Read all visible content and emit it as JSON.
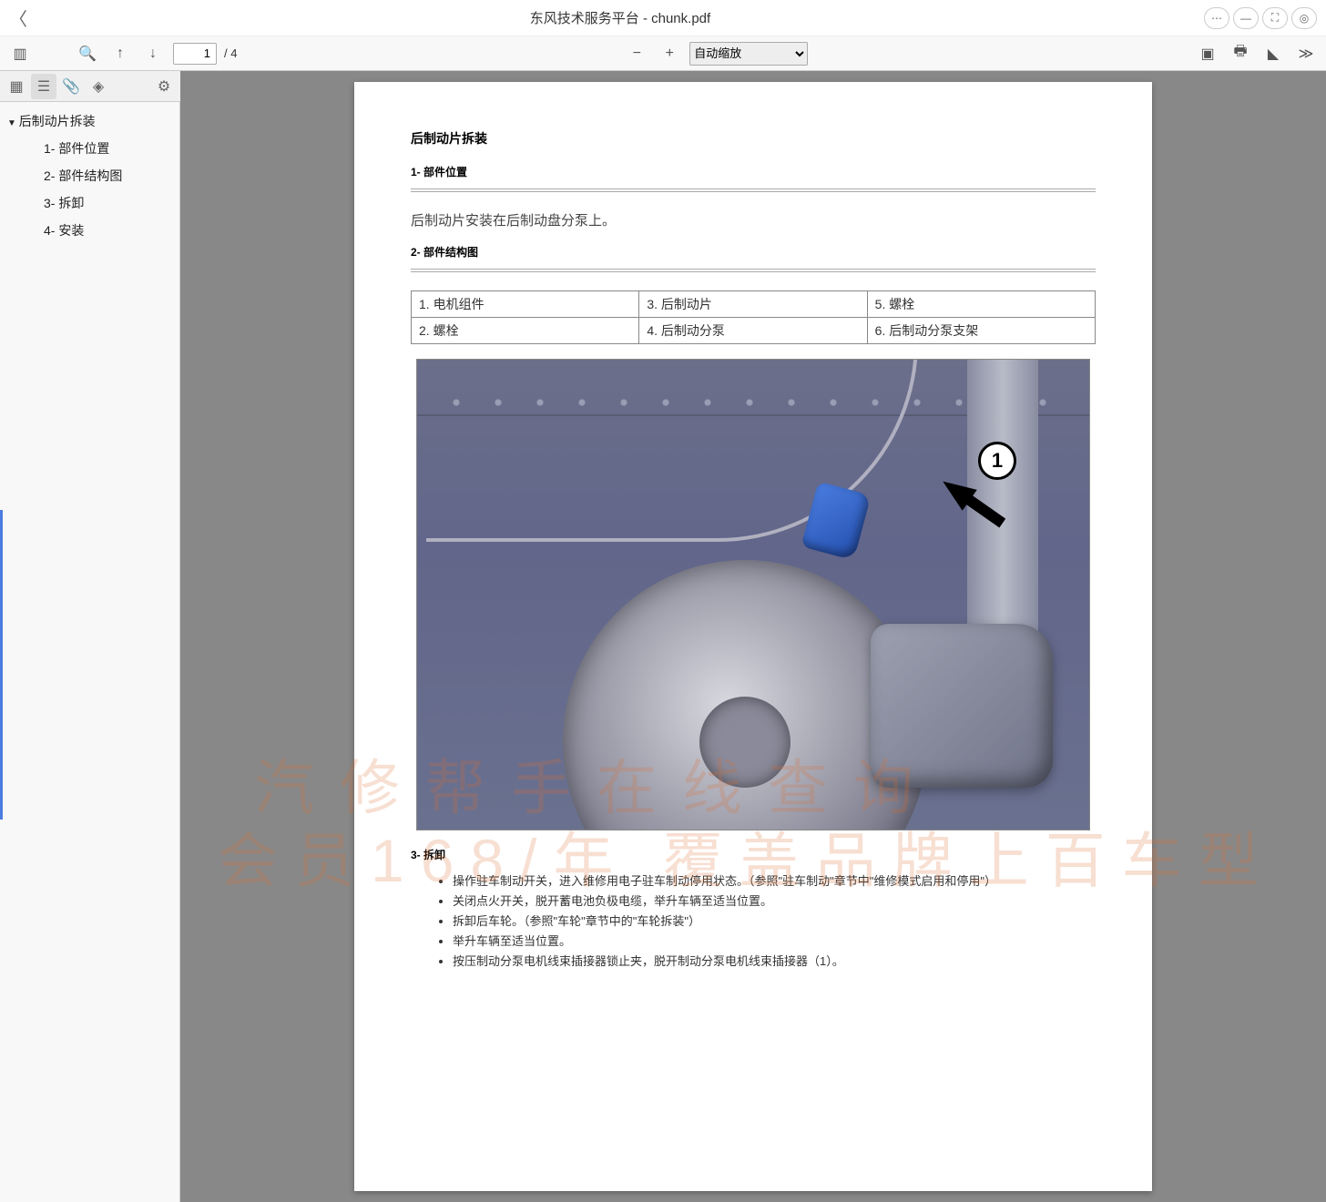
{
  "window": {
    "title": "东风技术服务平台 - chunk.pdf",
    "controls": {
      "more": "⋯",
      "min": "—",
      "max": "⛶",
      "target": "◎"
    }
  },
  "toolbar": {
    "page_current": "1",
    "page_total": "/ 4",
    "zoom_label": "自动缩放"
  },
  "outline": {
    "root": "后制动片拆装",
    "items": [
      "1- 部件位置",
      "2- 部件结构图",
      "3- 拆卸",
      "4- 安装"
    ]
  },
  "doc": {
    "title": "后制动片拆装",
    "sec1": "1- 部件位置",
    "body1": "后制动片安装在后制动盘分泵上。",
    "sec2": "2- 部件结构图",
    "table": {
      "r1c1": "1. 电机组件",
      "r1c2": "3. 后制动片",
      "r1c3": "5. 螺栓",
      "r2c1": "2. 螺栓",
      "r2c2": "4. 后制动分泵",
      "r2c3": "6. 后制动分泵支架"
    },
    "callout": "1",
    "sec3": "3- 拆卸",
    "bullets": [
      "操作驻车制动开关，进入维修用电子驻车制动停用状态。（参照\"驻车制动\"章节中\"维修模式启用和停用\"）",
      "关闭点火开关，脱开蓄电池负极电缆，举升车辆至适当位置。",
      "拆卸后车轮。（参照\"车轮\"章节中的\"车轮拆装\"）",
      "举升车辆至适当位置。",
      "按压制动分泵电机线束插接器锁止夹，脱开制动分泵电机线束插接器（1）。"
    ],
    "watermark1": "汽修帮手在线查询",
    "watermark2": "会员168/年 覆盖品牌上百车型"
  }
}
